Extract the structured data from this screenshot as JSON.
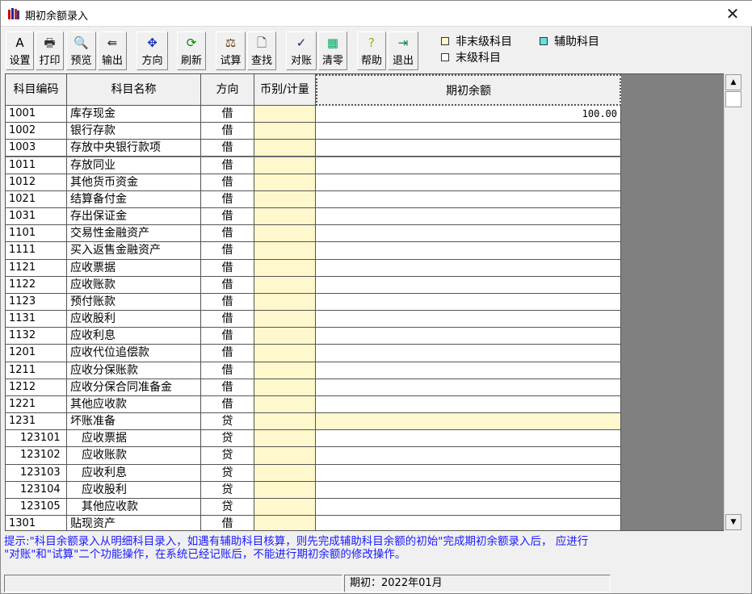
{
  "window": {
    "title": "期初余额录入",
    "close": "✕"
  },
  "toolbar": [
    {
      "label": "设置",
      "icon": "A"
    },
    {
      "label": "打印",
      "icon": "🖶"
    },
    {
      "label": "预览",
      "icon": "🔍"
    },
    {
      "label": "输出",
      "icon": "⇚"
    },
    {
      "label": "方向",
      "icon": "✥"
    },
    {
      "label": "刷新",
      "icon": "⟳"
    },
    {
      "label": "试算",
      "icon": "⚖"
    },
    {
      "label": "查找",
      "icon": "🗋"
    },
    {
      "label": "对账",
      "icon": "✓"
    },
    {
      "label": "清零",
      "icon": "▦"
    },
    {
      "label": "帮助",
      "icon": "?"
    },
    {
      "label": "退出",
      "icon": "⇥"
    }
  ],
  "legend": {
    "non_leaf": "非末级科目",
    "aux": "辅助科目",
    "leaf": "末级科目",
    "colors": {
      "non_leaf": "#fff8cc",
      "aux": "#66e0e0",
      "leaf": "#ffffff"
    }
  },
  "columns": [
    "科目编码",
    "科目名称",
    "方向",
    "币别/计量",
    "期初余额"
  ],
  "rows": [
    {
      "code": "1001",
      "name": "库存现金",
      "dir": "借",
      "bal": "100.00"
    },
    {
      "code": "1002",
      "name": "银行存款",
      "dir": "借",
      "bal": ""
    },
    {
      "code": "1003",
      "name": "存放中央银行款项",
      "dir": "借",
      "bal": ""
    },
    {
      "code": "1011",
      "name": "存放同业",
      "dir": "借",
      "bal": ""
    },
    {
      "code": "1012",
      "name": "其他货币资金",
      "dir": "借",
      "bal": ""
    },
    {
      "code": "1021",
      "name": "结算备付金",
      "dir": "借",
      "bal": ""
    },
    {
      "code": "1031",
      "name": "存出保证金",
      "dir": "借",
      "bal": ""
    },
    {
      "code": "1101",
      "name": "交易性金融资产",
      "dir": "借",
      "bal": ""
    },
    {
      "code": "1111",
      "name": "买入返售金融资产",
      "dir": "借",
      "bal": ""
    },
    {
      "code": "1121",
      "name": "应收票据",
      "dir": "借",
      "bal": ""
    },
    {
      "code": "1122",
      "name": "应收账款",
      "dir": "借",
      "bal": ""
    },
    {
      "code": "1123",
      "name": "预付账款",
      "dir": "借",
      "bal": ""
    },
    {
      "code": "1131",
      "name": "应收股利",
      "dir": "借",
      "bal": ""
    },
    {
      "code": "1132",
      "name": "应收利息",
      "dir": "借",
      "bal": ""
    },
    {
      "code": "1201",
      "name": "应收代位追偿款",
      "dir": "借",
      "bal": ""
    },
    {
      "code": "1211",
      "name": "应收分保账款",
      "dir": "借",
      "bal": ""
    },
    {
      "code": "1212",
      "name": "应收分保合同准备金",
      "dir": "借",
      "bal": ""
    },
    {
      "code": "1221",
      "name": "其他应收款",
      "dir": "借",
      "bal": ""
    },
    {
      "code": "1231",
      "name": "坏账准备",
      "dir": "贷",
      "bal": "",
      "nonleaf": true
    },
    {
      "code": "123101",
      "name": "应收票据",
      "dir": "贷",
      "bal": "",
      "sub": true
    },
    {
      "code": "123102",
      "name": "应收账款",
      "dir": "贷",
      "bal": "",
      "sub": true
    },
    {
      "code": "123103",
      "name": "应收利息",
      "dir": "贷",
      "bal": "",
      "sub": true
    },
    {
      "code": "123104",
      "name": "应收股利",
      "dir": "贷",
      "bal": "",
      "sub": true
    },
    {
      "code": "123105",
      "name": "其他应收款",
      "dir": "贷",
      "bal": "",
      "sub": true
    },
    {
      "code": "1301",
      "name": "贴现资产",
      "dir": "借",
      "bal": ""
    }
  ],
  "hint": {
    "line1": "提示:\"科目余额录入从明细科目录入，如遇有辅助科目核算，则先完成辅助科目余额的初始\"完成期初余额录入后，          应进行",
    "line2": "\"对账\"和\"试算\"二个功能操作，在系统已经记账后，不能进行期初余额的修改操作。"
  },
  "status": {
    "left": "",
    "period": "期初：2022年01月"
  }
}
